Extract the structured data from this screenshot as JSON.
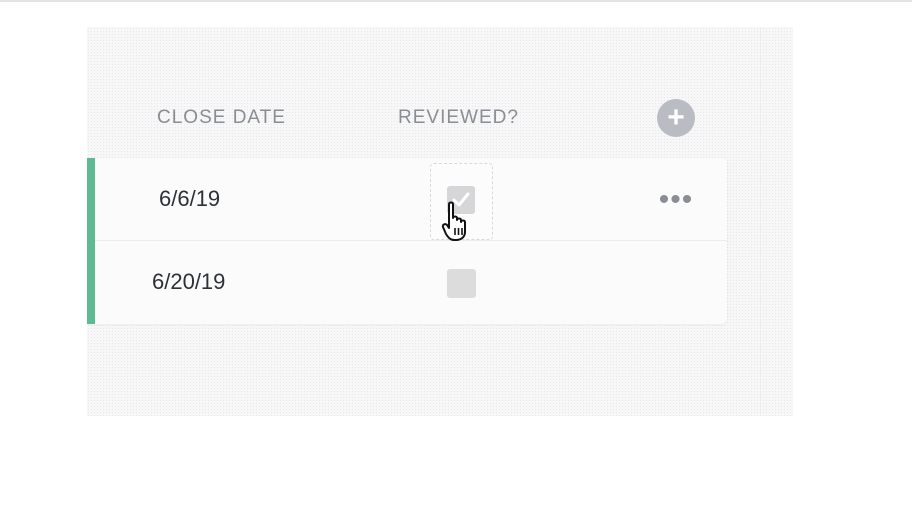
{
  "table": {
    "columns": [
      "CLOSE DATE",
      "REVIEWED?"
    ],
    "add_column_icon": "plus-circle-icon",
    "rows": [
      {
        "close_date": "6/6/19",
        "reviewed": false,
        "hovered": true
      },
      {
        "close_date": "6/20/19",
        "reviewed": false,
        "hovered": false
      }
    ],
    "row_menu_icon": "ellipsis-icon"
  },
  "colors": {
    "accent": "#5dba92",
    "header_text": "#8a8d94",
    "row_text": "#2e3138"
  },
  "cursor": "hand-pointer-icon"
}
